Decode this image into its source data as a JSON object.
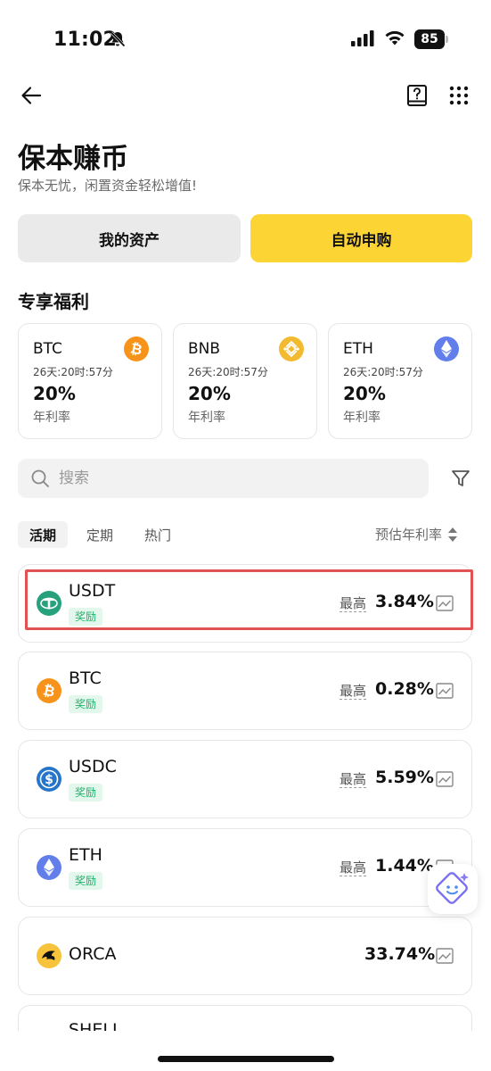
{
  "status": {
    "time": "11:02",
    "battery": "85"
  },
  "page": {
    "title": "保本赚币",
    "subtitle": "保本无忧，闲置资金轻松增值!"
  },
  "buttons": {
    "assets": "我的资产",
    "auto": "自动申购"
  },
  "benefits": {
    "heading": "专享福利",
    "cards": [
      {
        "symbol": "BTC",
        "countdown": "26天:20时:57分",
        "rate": "20%",
        "label": "年利率",
        "icon": "btc-icon",
        "color": "#f7931a"
      },
      {
        "symbol": "BNB",
        "countdown": "26天:20时:57分",
        "rate": "20%",
        "label": "年利率",
        "icon": "bnb-icon",
        "color": "#f3ba2f"
      },
      {
        "symbol": "ETH",
        "countdown": "26天:20时:57分",
        "rate": "20%",
        "label": "年利率",
        "icon": "eth-icon",
        "color": "#627eea"
      }
    ]
  },
  "search": {
    "placeholder": "搜索",
    "value": ""
  },
  "tabs": [
    "活期",
    "定期",
    "热门"
  ],
  "sort_label": "预估年利率",
  "list": [
    {
      "name": "USDT",
      "badge": "奖励",
      "max_label": "最高",
      "apy": "3.84%",
      "icon": "usdt-icon"
    },
    {
      "name": "BTC",
      "badge": "奖励",
      "max_label": "最高",
      "apy": "0.28%",
      "icon": "btc-icon"
    },
    {
      "name": "USDC",
      "badge": "奖励",
      "max_label": "最高",
      "apy": "5.59%",
      "icon": "usdc-icon"
    },
    {
      "name": "ETH",
      "badge": "奖励",
      "max_label": "最高",
      "apy": "1.44%",
      "icon": "eth-icon"
    },
    {
      "name": "ORCA",
      "apy": "33.74%",
      "icon": "orca-icon"
    },
    {
      "name": "SHELL",
      "icon": "shell-icon"
    }
  ],
  "colors": {
    "accent": "#fcd535",
    "reward_text": "#20b26c",
    "highlight": "#e35252"
  }
}
